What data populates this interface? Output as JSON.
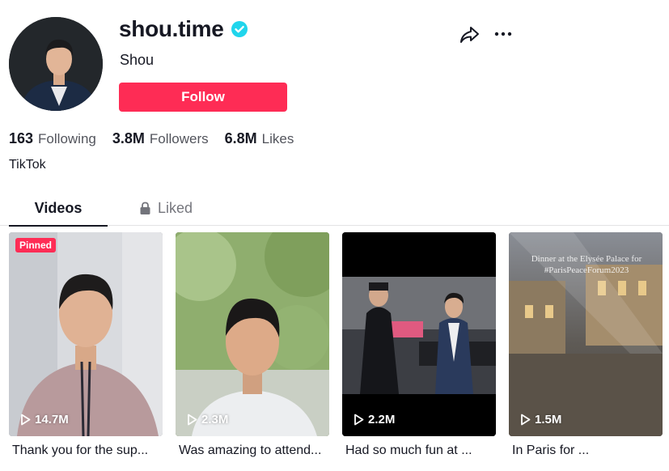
{
  "profile": {
    "username": "shou.time",
    "nickname": "Shou",
    "follow_label": "Follow",
    "bio": "TikTok"
  },
  "stats": {
    "following_count": "163",
    "following_label": "Following",
    "followers_count": "3.8M",
    "followers_label": "Followers",
    "likes_count": "6.8M",
    "likes_label": "Likes"
  },
  "tabs": {
    "videos": "Videos",
    "liked": "Liked"
  },
  "videos": [
    {
      "badge": "Pinned",
      "views": "14.7M",
      "caption": "Thank you for the sup..."
    },
    {
      "views": "2.3M",
      "caption": "Was amazing to attend..."
    },
    {
      "views": "2.2M",
      "caption": "Had so much fun at ..."
    },
    {
      "views": "1.5M",
      "caption": "In Paris for ...",
      "overlay_text": "Dinner at the Elysée Palace for #ParisPeaceForum2023"
    }
  ],
  "colors": {
    "accent": "#fe2c55",
    "verified": "#20d5ec",
    "text": "#161823"
  },
  "icons": {
    "verified": "verified-badge-icon",
    "share": "share-arrow-icon",
    "more": "more-dots-icon",
    "lock": "lock-icon",
    "play": "play-icon"
  }
}
